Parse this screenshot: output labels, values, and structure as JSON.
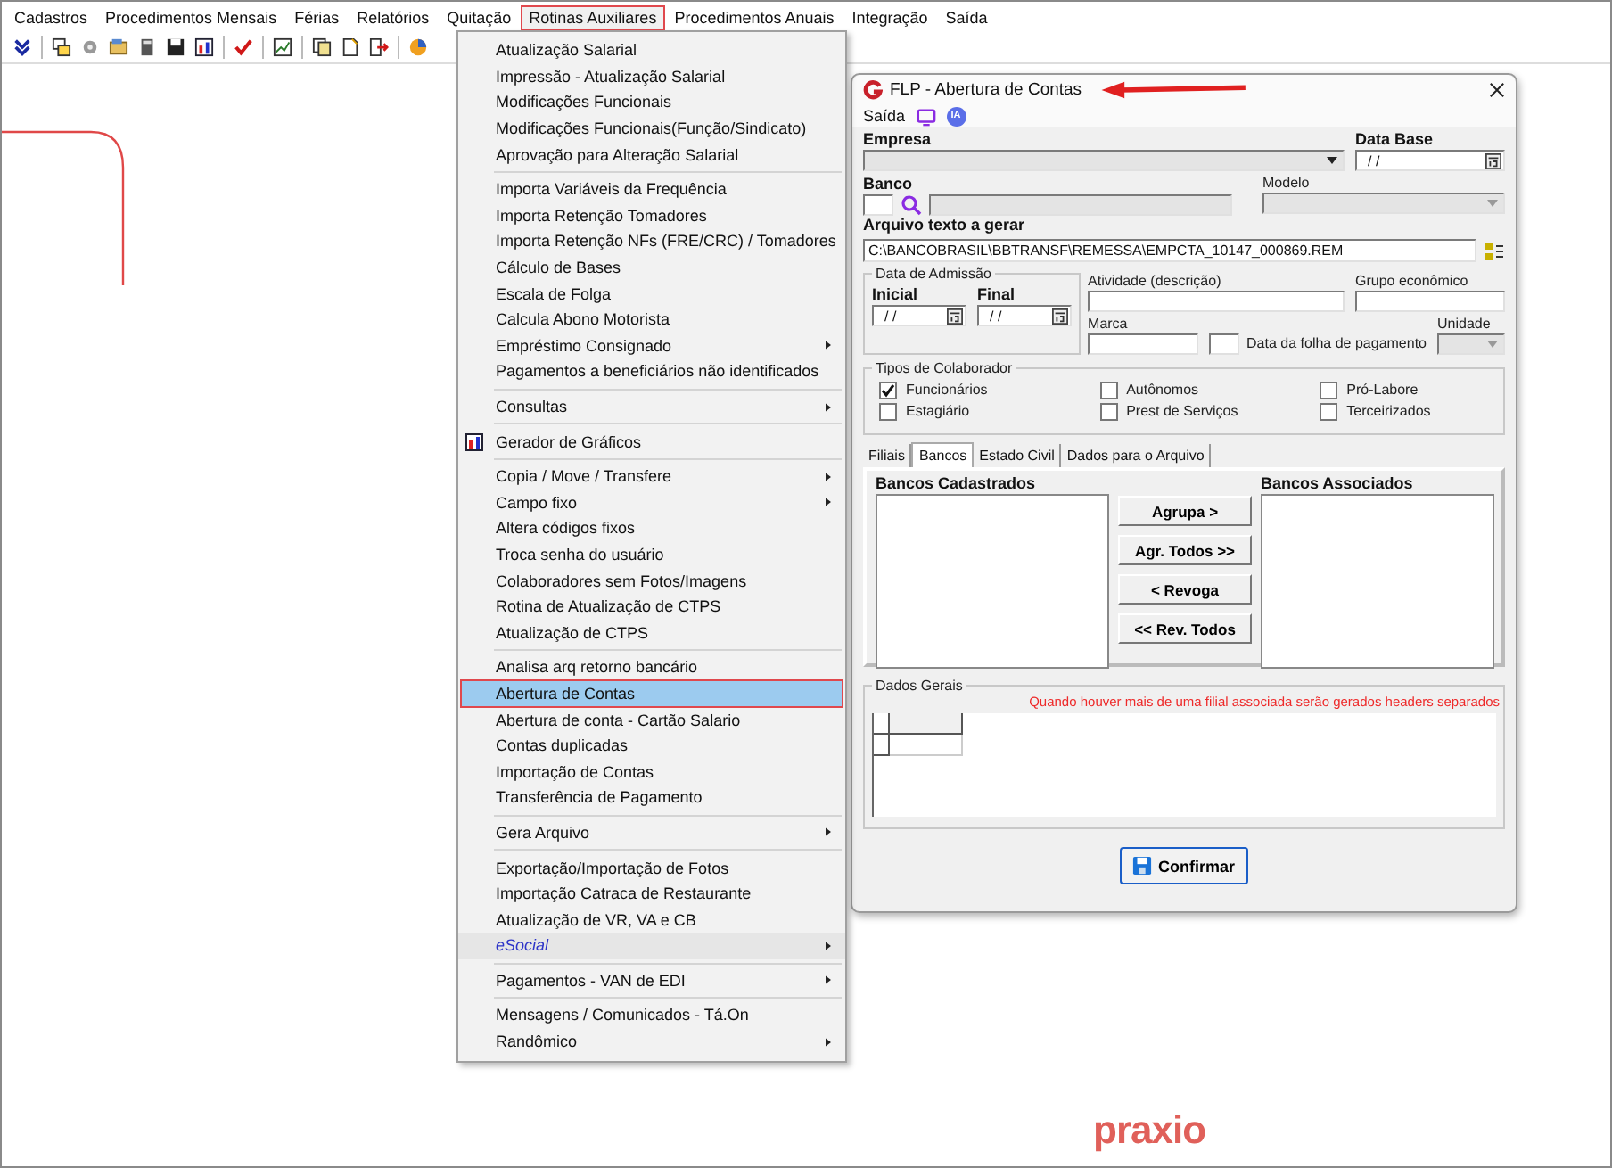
{
  "menu_bar": [
    {
      "label": "Cadastros",
      "selected": false
    },
    {
      "label": "Procedimentos Mensais",
      "selected": false
    },
    {
      "label": "Férias",
      "selected": false
    },
    {
      "label": "Relatórios",
      "selected": false
    },
    {
      "label": "Quitação",
      "selected": false
    },
    {
      "label": "Rotinas Auxiliares",
      "selected": true
    },
    {
      "label": "Procedimentos Anuais",
      "selected": false
    },
    {
      "label": "Integração",
      "selected": false
    },
    {
      "label": "Saída",
      "selected": false
    }
  ],
  "dropdown": {
    "sections": [
      [
        {
          "label": "Atualização Salarial",
          "kind": "plain",
          "submenu": false,
          "selected": false
        },
        {
          "label": "Impressão - Atualização Salarial",
          "kind": "plain",
          "submenu": false,
          "selected": false
        },
        {
          "label": "Modificações Funcionais",
          "kind": "plain",
          "submenu": false,
          "selected": false
        },
        {
          "label": "Modificações Funcionais(Função/Sindicato)",
          "kind": "plain",
          "submenu": false,
          "selected": false
        },
        {
          "label": "Aprovação para Alteração Salarial",
          "kind": "plain",
          "submenu": false,
          "selected": false
        }
      ],
      [
        {
          "label": "Importa Variáveis da Frequência",
          "kind": "plain",
          "submenu": false,
          "selected": false
        },
        {
          "label": "Importa Retenção Tomadores",
          "kind": "plain",
          "submenu": false,
          "selected": false
        },
        {
          "label": "Importa Retenção NFs (FRE/CRC) / Tomadores",
          "kind": "plain",
          "submenu": false,
          "selected": false
        },
        {
          "label": "Cálculo de Bases",
          "kind": "plain",
          "submenu": false,
          "selected": false
        },
        {
          "label": "Escala de Folga",
          "kind": "plain",
          "submenu": false,
          "selected": false
        },
        {
          "label": "Calcula Abono Motorista",
          "kind": "plain",
          "submenu": false,
          "selected": false
        },
        {
          "label": "Empréstimo Consignado",
          "kind": "plain",
          "submenu": true,
          "selected": false
        },
        {
          "label": "Pagamentos a beneficiários não identificados",
          "kind": "plain",
          "submenu": false,
          "selected": false
        }
      ],
      [
        {
          "label": "Consultas",
          "kind": "plain",
          "submenu": true,
          "selected": false
        }
      ],
      [
        {
          "label": "Gerador de Gráficos",
          "kind": "icon",
          "submenu": false,
          "selected": false
        }
      ],
      [
        {
          "label": "Copia / Move / Transfere",
          "kind": "plain",
          "submenu": true,
          "selected": false
        },
        {
          "label": "Campo fixo",
          "kind": "plain",
          "submenu": true,
          "selected": false
        },
        {
          "label": "Altera códigos fixos",
          "kind": "plain",
          "submenu": false,
          "selected": false
        },
        {
          "label": "Troca senha do usuário",
          "kind": "plain",
          "submenu": false,
          "selected": false
        },
        {
          "label": "Colaboradores sem Fotos/Imagens",
          "kind": "plain",
          "submenu": false,
          "selected": false
        },
        {
          "label": "Rotina de Atualização de CTPS",
          "kind": "plain",
          "submenu": false,
          "selected": false
        },
        {
          "label": "Atualização de CTPS",
          "kind": "plain",
          "submenu": false,
          "selected": false
        }
      ],
      [
        {
          "label": "Analisa arq retorno bancário",
          "kind": "plain",
          "submenu": false,
          "selected": false
        },
        {
          "label": "Abertura de Contas",
          "kind": "plain",
          "submenu": false,
          "selected": true
        },
        {
          "label": "Abertura de conta - Cartão Salario",
          "kind": "plain",
          "submenu": false,
          "selected": false
        },
        {
          "label": "Contas duplicadas",
          "kind": "plain",
          "submenu": false,
          "selected": false
        },
        {
          "label": "Importação de Contas",
          "kind": "plain",
          "submenu": false,
          "selected": false
        },
        {
          "label": "Transferência de Pagamento",
          "kind": "plain",
          "submenu": false,
          "selected": false
        }
      ],
      [
        {
          "label": "Gera Arquivo",
          "kind": "plain",
          "submenu": true,
          "selected": false
        }
      ],
      [
        {
          "label": "Exportação/Importação de Fotos",
          "kind": "plain",
          "submenu": false,
          "selected": false
        },
        {
          "label": "Importação Catraca de Restaurante",
          "kind": "plain",
          "submenu": false,
          "selected": false
        },
        {
          "label": "Atualização de VR, VA e CB",
          "kind": "plain",
          "submenu": false,
          "selected": false
        },
        {
          "label": "eSocial",
          "kind": "accent",
          "submenu": true,
          "selected": false
        }
      ],
      [
        {
          "label": "Pagamentos - VAN de EDI",
          "kind": "plain",
          "submenu": true,
          "selected": false
        }
      ],
      [
        {
          "label": "Mensagens / Comunicados - Tá.On",
          "kind": "plain",
          "submenu": false,
          "selected": false
        },
        {
          "label": "Randômico",
          "kind": "plain",
          "submenu": true,
          "selected": false
        }
      ]
    ]
  },
  "dialog": {
    "title": "FLP - Abertura de Contas",
    "menu_label": "Saída",
    "ia_badge": "IA",
    "empresa_label": "Empresa",
    "data_base": {
      "label": "Data Base",
      "value": "/ /"
    },
    "banco_label": "Banco",
    "modelo_label": "Modelo",
    "arquivo": {
      "label": "Arquivo texto a gerar",
      "value": "C:\\BANCOBRASIL\\BBTRANSF\\REMESSA\\EMPCTA_10147_000869.REM"
    },
    "data_admissao": {
      "title": "Data de Admissão",
      "inicial": {
        "label": "Inicial",
        "value": "/ /"
      },
      "final": {
        "label": "Final",
        "value": "/ /"
      }
    },
    "atividade_label": "Atividade (descrição)",
    "grupo_label": "Grupo econômico",
    "marca_label": "Marca",
    "data_folha_label": "Data da folha de pagamento",
    "unidade_label": "Unidade",
    "tipos": {
      "title": "Tipos de Colaborador",
      "options": [
        {
          "label": "Funcionários",
          "checked": true
        },
        {
          "label": "Autônomos",
          "checked": false
        },
        {
          "label": "Pró-Labore",
          "checked": false
        },
        {
          "label": "Estagiário",
          "checked": false
        },
        {
          "label": "Prest de Serviços",
          "checked": false
        },
        {
          "label": "Terceirizados",
          "checked": false
        }
      ]
    },
    "tabs": [
      {
        "label": "Filiais",
        "selected": false
      },
      {
        "label": "Bancos",
        "selected": true
      },
      {
        "label": "Estado Civil",
        "selected": false
      },
      {
        "label": "Dados para o Arquivo",
        "selected": false
      }
    ],
    "bancos_cadastrados": "Bancos Cadastrados",
    "bancos_associados": "Bancos Associados",
    "transfer_buttons": [
      "Agrupa >",
      "Agr. Todos >>",
      "< Revoga",
      "<< Rev. Todos"
    ],
    "dados_gerais": {
      "title": "Dados Gerais",
      "note": "Quando houver mais de uma filial associada serão gerados headers separados"
    },
    "confirm_button": "Confirmar"
  },
  "logo": "praxio"
}
